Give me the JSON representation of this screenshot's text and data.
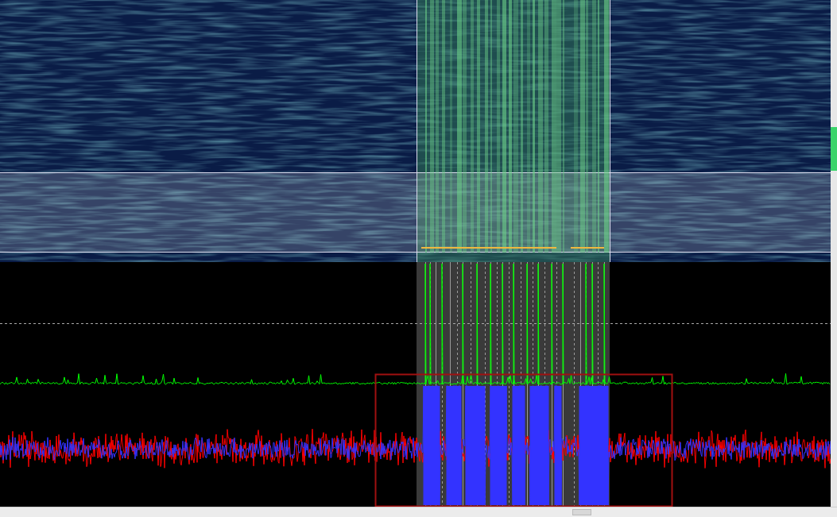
{
  "traces": [
    {
      "kind": "amplitude",
      "color": "#00ff00"
    },
    {
      "kind": "in-phase",
      "color": "#ff0000"
    },
    {
      "kind": "quadrature",
      "color": "#3333ff"
    }
  ]
}
